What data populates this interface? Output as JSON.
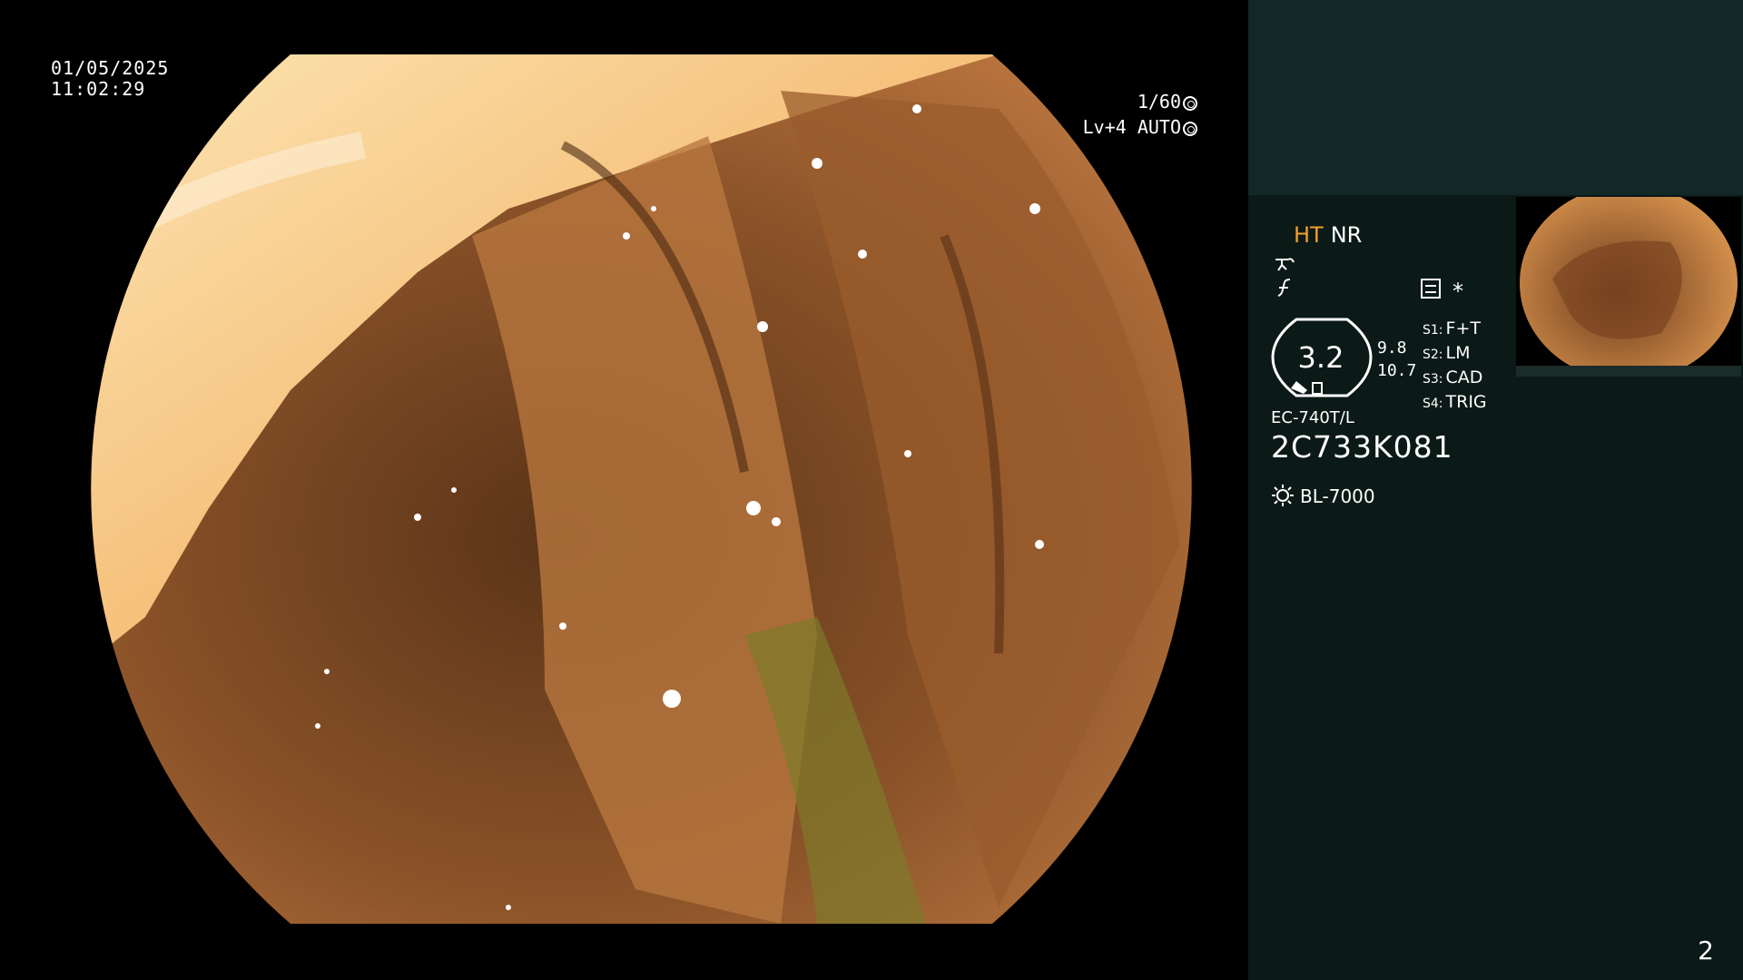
{
  "overlay": {
    "date": "01/05/2025",
    "time": "11:02:29",
    "shutter": "1/60",
    "level": "Lv+4 AUTO"
  },
  "panel": {
    "mode_ht": "HT",
    "mode_nr": "NR",
    "zoom": "3.2",
    "zoom_values": [
      "9.8",
      "10.7"
    ],
    "settings": [
      {
        "key": "S1:",
        "value": "F+T"
      },
      {
        "key": "S2:",
        "value": "LM"
      },
      {
        "key": "S3:",
        "value": "CAD"
      },
      {
        "key": "S4:",
        "value": "TRIG"
      }
    ],
    "scope_model": "EC-740T/L",
    "serial": "2C733K081",
    "light_source": "BL-7000",
    "star": "*"
  },
  "page_number": "2",
  "colors": {
    "accent": "#f1a22b",
    "panel_bg": "#0b1917",
    "panel_top": "#112826"
  }
}
